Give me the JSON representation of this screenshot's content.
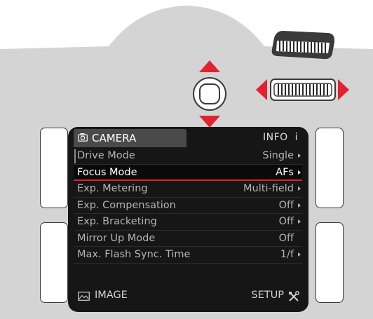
{
  "colors": {
    "body_gray": "#d4d4d4",
    "accent_red": "#e2222e",
    "screen_bg": "#161616"
  },
  "header": {
    "tab_label": "CAMERA",
    "tab_icon": "camera-icon",
    "info_label": "INFO  i"
  },
  "menu": {
    "items": [
      {
        "label": "Drive Mode",
        "value": "Single",
        "has_arrow": true
      },
      {
        "label": "Focus Mode",
        "value": "AFs",
        "has_arrow": true,
        "selected": true
      },
      {
        "label": "Exp. Metering",
        "value": "Multi-field",
        "has_arrow": true
      },
      {
        "label": "Exp. Compensation",
        "value": "Off",
        "has_arrow": true
      },
      {
        "label": "Exp. Bracketing",
        "value": "Off",
        "has_arrow": true
      },
      {
        "label": "Mirror Up Mode",
        "value": "Off",
        "has_arrow": false
      },
      {
        "label": "Max. Flash Sync. Time",
        "value": "1/f",
        "has_arrow": true
      }
    ]
  },
  "footer": {
    "image_label": "IMAGE",
    "image_icon": "image-icon",
    "setup_label": "SETUP",
    "setup_icon": "tools-icon"
  }
}
